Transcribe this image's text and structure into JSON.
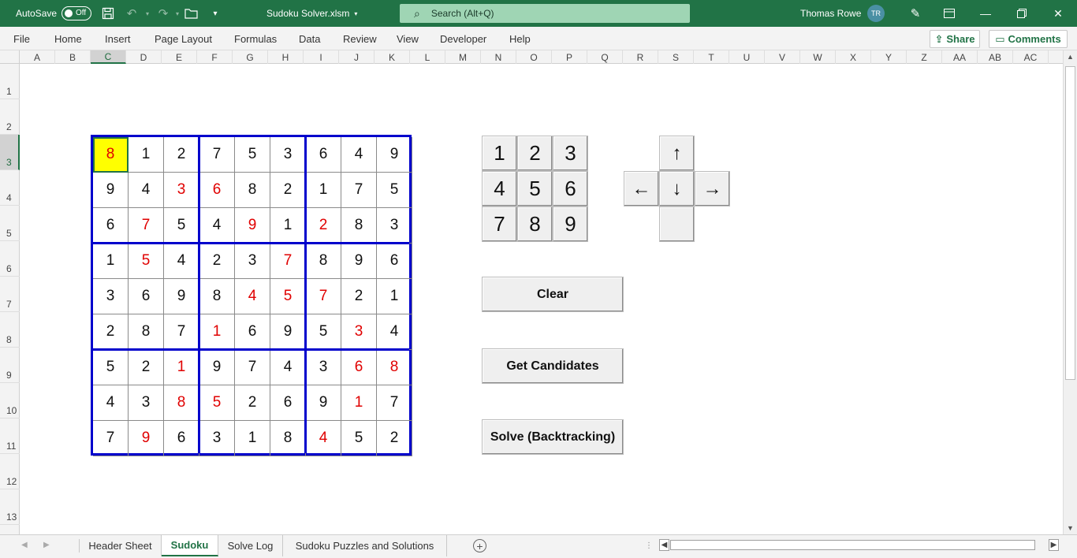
{
  "titlebar": {
    "autosave_label": "AutoSave",
    "autosave_state": "Off",
    "doc_title": "Sudoku Solver.xlsm",
    "search_placeholder": "Search (Alt+Q)",
    "user_name": "Thomas Rowe",
    "user_initials": "TR",
    "brand_color": "#217346"
  },
  "menu": {
    "items": [
      "File",
      "Home",
      "Insert",
      "Page Layout",
      "Formulas",
      "Data",
      "Review",
      "View",
      "Developer",
      "Help"
    ],
    "share_label": "Share",
    "comments_label": "Comments"
  },
  "columns": [
    "A",
    "B",
    "C",
    "D",
    "E",
    "F",
    "G",
    "H",
    "I",
    "J",
    "K",
    "L",
    "M",
    "N",
    "O",
    "P",
    "Q",
    "R",
    "S",
    "T",
    "U",
    "V",
    "W",
    "X",
    "Y",
    "Z",
    "AA",
    "AB",
    "AC"
  ],
  "selected_column": "C",
  "rows": [
    "1",
    "2",
    "3",
    "4",
    "5",
    "6",
    "7",
    "8",
    "9",
    "10",
    "11",
    "12",
    "13"
  ],
  "selected_row": "3",
  "sudoku": {
    "grid": [
      [
        8,
        1,
        2,
        7,
        5,
        3,
        6,
        4,
        9
      ],
      [
        9,
        4,
        3,
        6,
        8,
        2,
        1,
        7,
        5
      ],
      [
        6,
        7,
        5,
        4,
        9,
        1,
        2,
        8,
        3
      ],
      [
        1,
        5,
        4,
        2,
        3,
        7,
        8,
        9,
        6
      ],
      [
        3,
        6,
        9,
        8,
        4,
        5,
        7,
        2,
        1
      ],
      [
        2,
        8,
        7,
        1,
        6,
        9,
        5,
        3,
        4
      ],
      [
        5,
        2,
        1,
        9,
        7,
        4,
        3,
        6,
        8
      ],
      [
        4,
        3,
        8,
        5,
        2,
        6,
        9,
        1,
        7
      ],
      [
        7,
        9,
        6,
        3,
        1,
        8,
        4,
        5,
        2
      ]
    ],
    "solved_mask": [
      [
        1,
        0,
        0,
        0,
        0,
        0,
        0,
        0,
        0
      ],
      [
        0,
        0,
        1,
        1,
        0,
        0,
        0,
        0,
        0
      ],
      [
        0,
        1,
        0,
        0,
        1,
        0,
        1,
        0,
        0
      ],
      [
        0,
        1,
        0,
        0,
        0,
        1,
        0,
        0,
        0
      ],
      [
        0,
        0,
        0,
        0,
        1,
        1,
        1,
        0,
        0
      ],
      [
        0,
        0,
        0,
        1,
        0,
        0,
        0,
        1,
        0
      ],
      [
        0,
        0,
        1,
        0,
        0,
        0,
        0,
        1,
        1
      ],
      [
        0,
        0,
        1,
        1,
        0,
        0,
        0,
        1,
        0
      ],
      [
        0,
        1,
        0,
        0,
        0,
        0,
        1,
        0,
        0
      ]
    ],
    "active_cell": [
      0,
      0
    ],
    "given_color": "#111111",
    "solved_color": "#e00000",
    "border_color": "#0000cc",
    "active_fill": "#ffff00"
  },
  "keypad": {
    "digits": [
      "1",
      "2",
      "3",
      "4",
      "5",
      "6",
      "7",
      "8",
      "9"
    ],
    "arrows": {
      "up": "↑",
      "left": "←",
      "down": "↓",
      "right": "→"
    }
  },
  "buttons": {
    "clear": "Clear",
    "candidates": "Get Candidates",
    "solve": "Solve (Backtracking)"
  },
  "sheets": {
    "tabs": [
      "Header Sheet",
      "Sudoku",
      "Solve Log",
      "Sudoku Puzzles and Solutions"
    ],
    "active": "Sudoku"
  }
}
